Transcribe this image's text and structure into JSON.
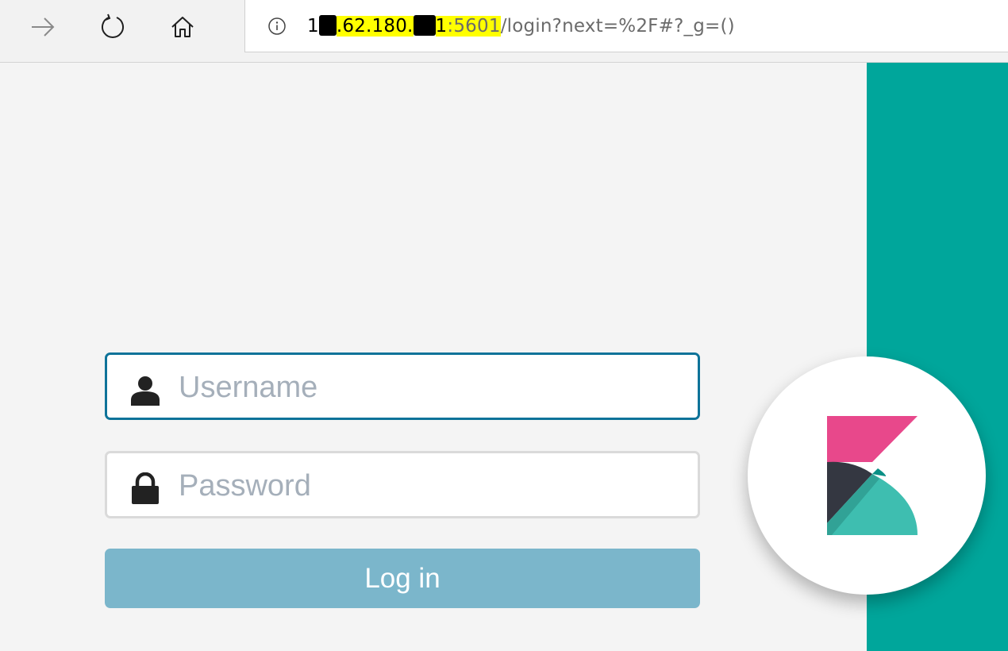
{
  "browser": {
    "url": {
      "host_prefix": "1",
      "host_middle": ".62.180.",
      "host_end": "1",
      "port": ":5601",
      "path": "/login?next=%2F#?_g=()"
    },
    "icons": {
      "forward": "arrow-right-icon",
      "reload": "reload-icon",
      "home": "home-icon",
      "site_info": "info-icon"
    }
  },
  "login": {
    "username_placeholder": "Username",
    "password_placeholder": "Password",
    "submit_label": "Log in"
  },
  "colors": {
    "accent_panel": "#00a69b",
    "focus_border": "#0e7399",
    "button": "#7bb6cb",
    "logo_pink": "#e8488b",
    "logo_dark": "#343741",
    "logo_teal": "#3ebeb0"
  }
}
